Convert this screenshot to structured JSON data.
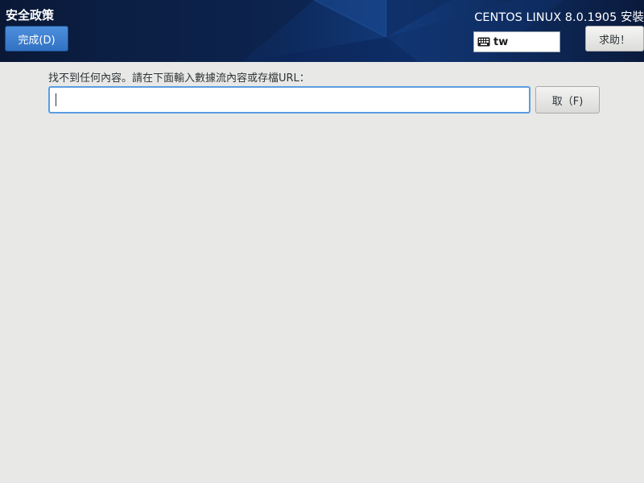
{
  "header": {
    "spoke_title": "安全政策",
    "done_label": "完成(D)",
    "product_title": "CENTOS LINUX 8.0.1905 安裝",
    "keyboard_layout": "tw",
    "help_label": "求助！"
  },
  "content": {
    "prompt": "找不到任何內容。請在下面輸入數據流內容或存檔URL：",
    "url_input_value": "",
    "fetch_label": "取（F)"
  },
  "icons": {
    "keyboard": "keyboard-icon"
  }
}
